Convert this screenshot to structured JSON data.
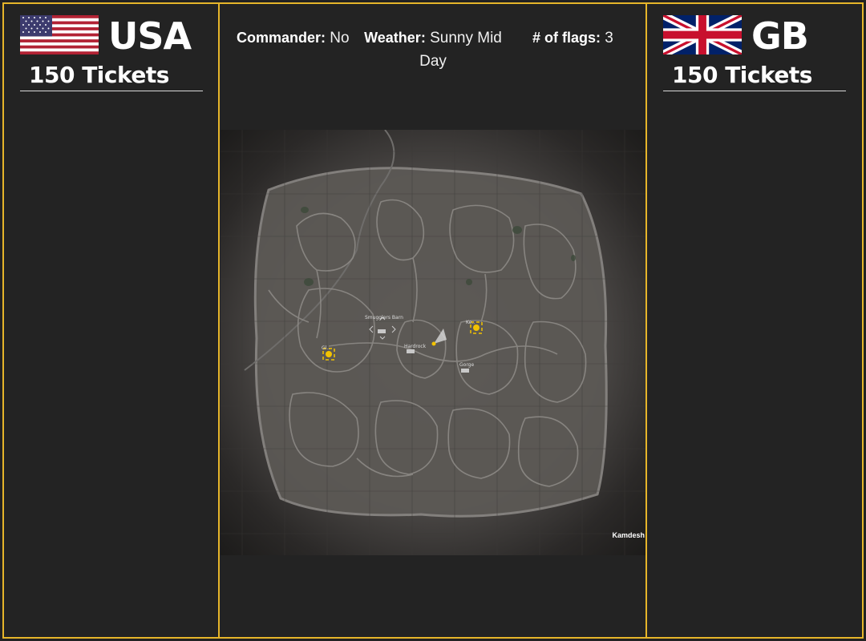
{
  "teams": {
    "left": {
      "name": "USA",
      "tickets": "150 Tickets",
      "flag_icon": "us-flag-icon"
    },
    "right": {
      "name": "GB",
      "tickets": "150 Tickets",
      "flag_icon": "uk-flag-icon"
    }
  },
  "match_info": {
    "commander_label": "Commander:",
    "commander_value": "No",
    "weather_label": "Weather:",
    "weather_value": "Sunny Mid Day",
    "flags_label": "# of flags:",
    "flags_value": "3"
  },
  "map": {
    "name": "Kamdesh",
    "labels": [
      "Smugglers Barn",
      "Hardrock",
      "Gorge",
      "Gl..",
      "Ke.."
    ]
  },
  "colors": {
    "border": "#e6b52a",
    "panel_bg": "#232323",
    "objective": "#f2c200"
  }
}
